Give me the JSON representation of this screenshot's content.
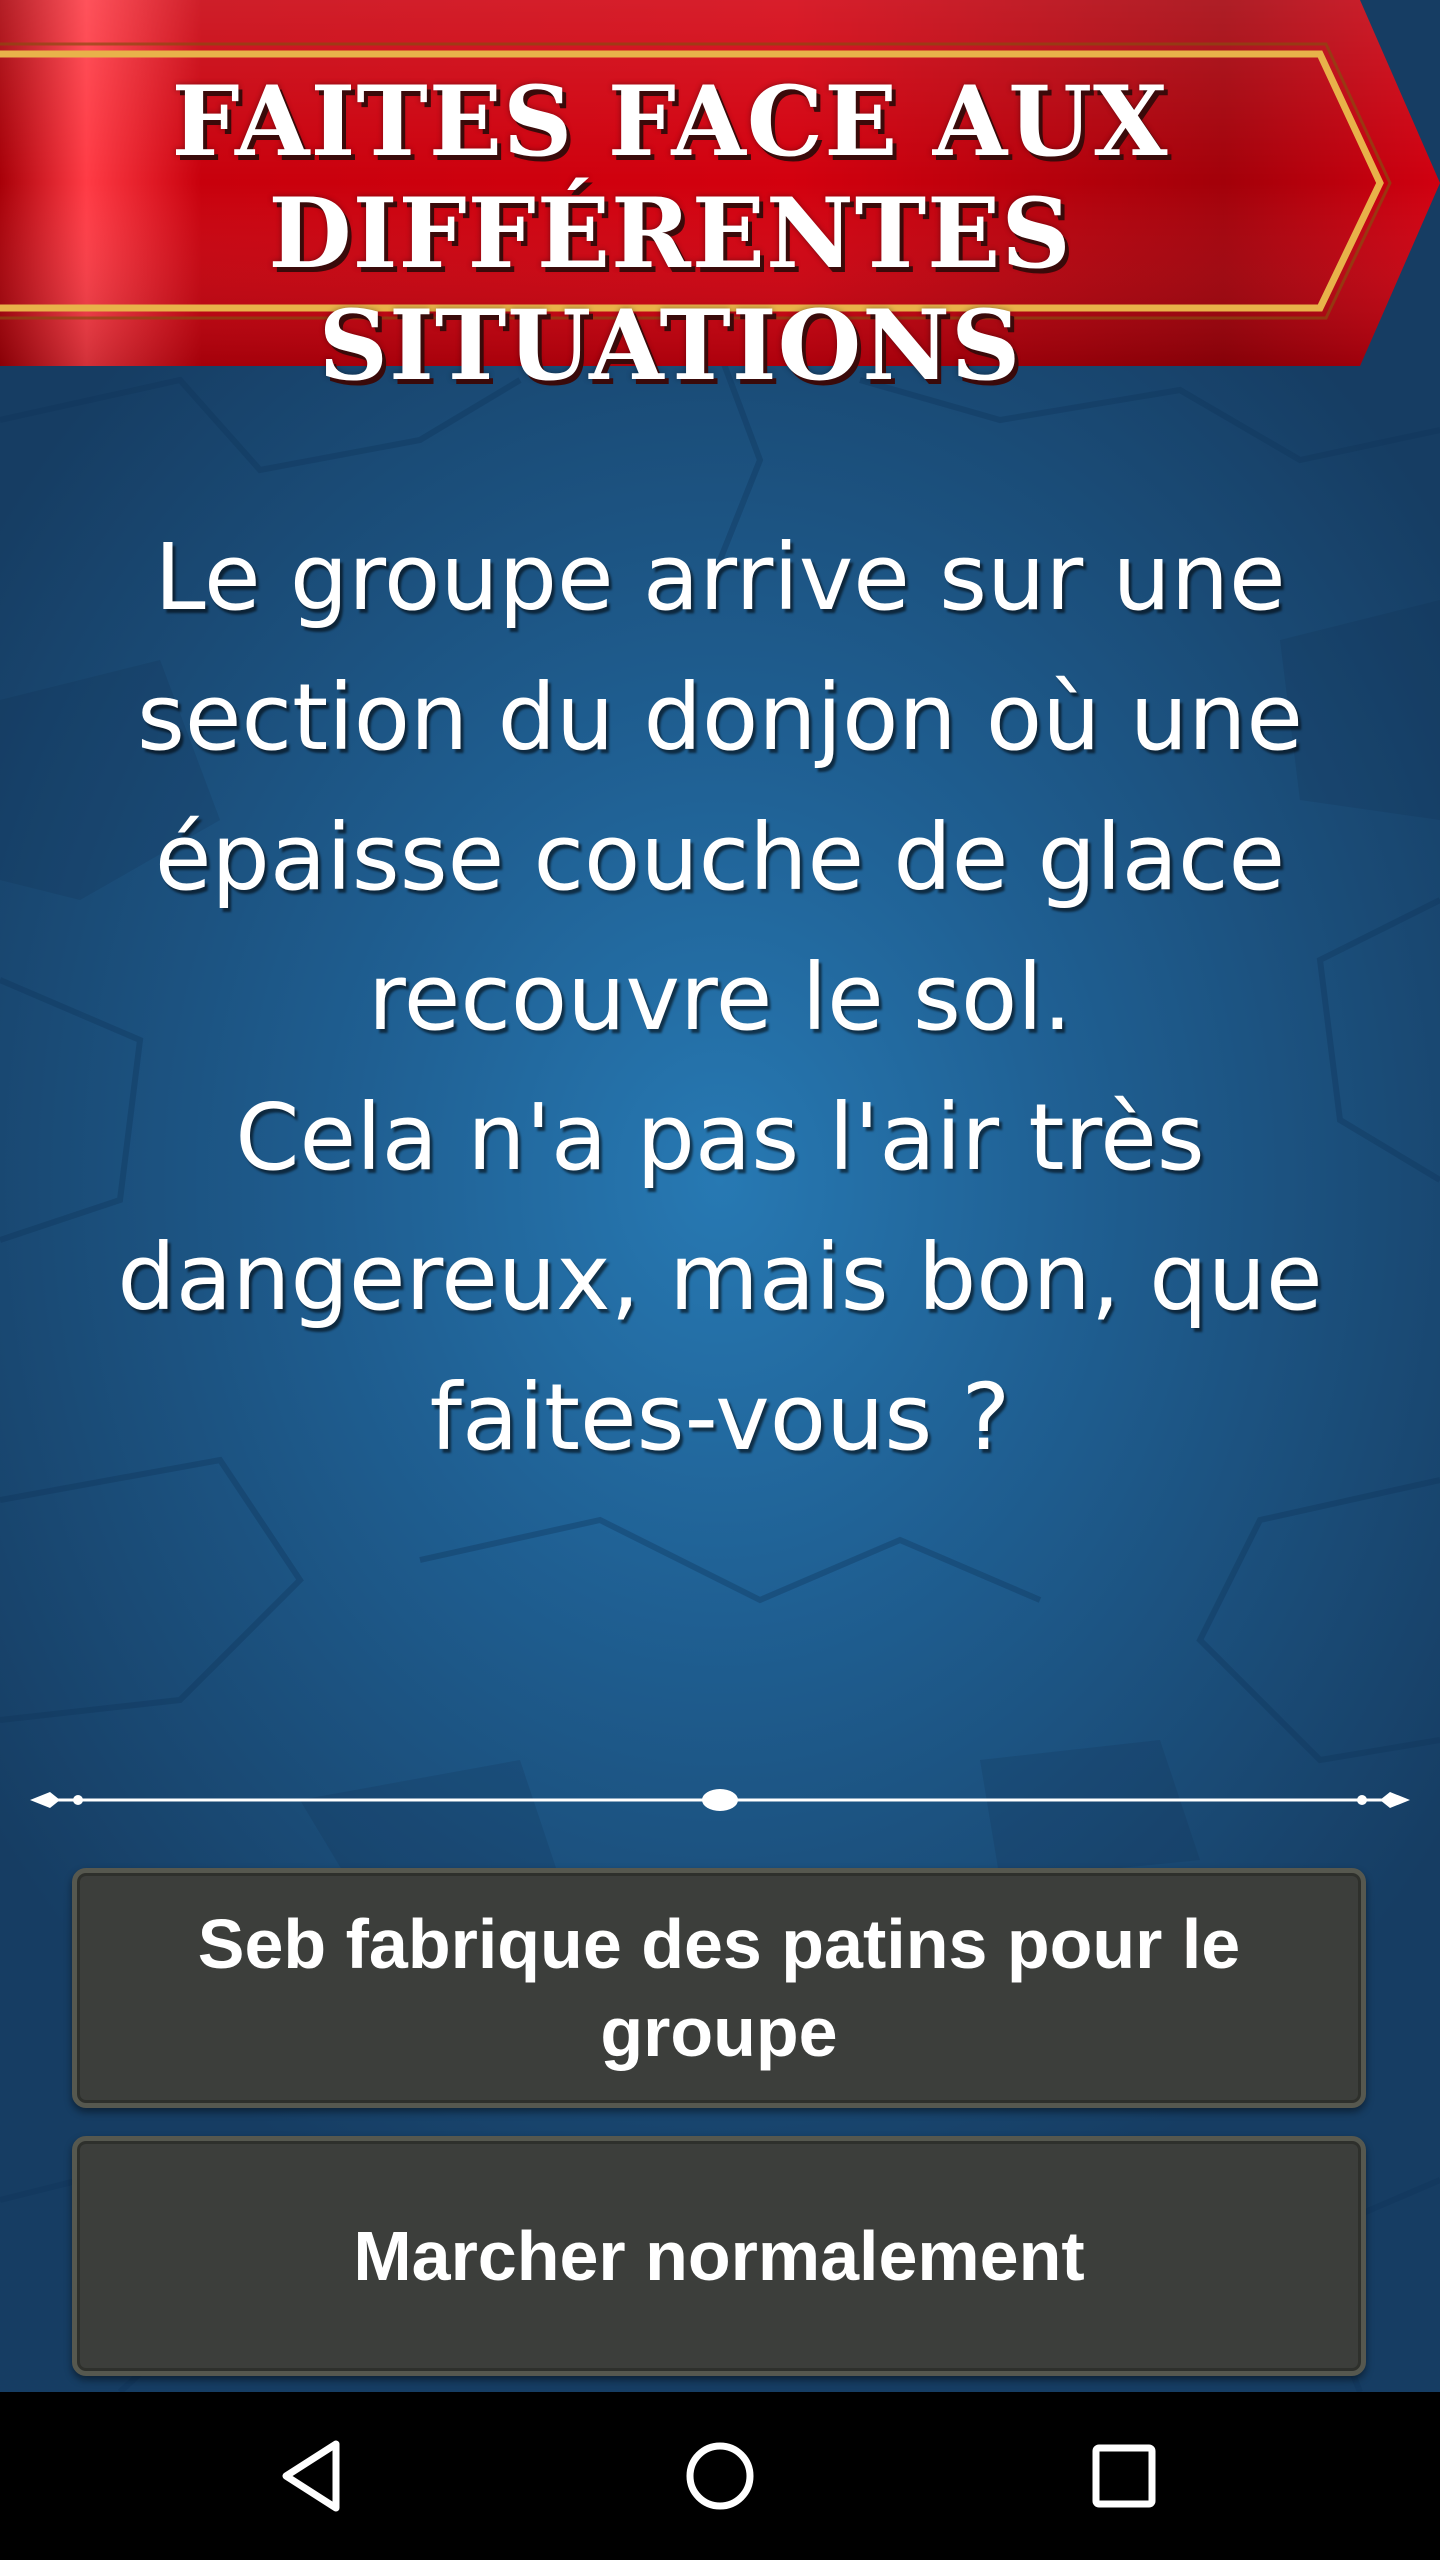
{
  "banner": {
    "line1": "FAITES FACE AUX",
    "line2": "DIFFÉRENTES SITUATIONS"
  },
  "story": {
    "lines": [
      "Le groupe arrive sur une",
      "section du donjon où une",
      "épaisse couche de glace",
      "recouvre le sol.",
      "Cela n'a pas l'air très",
      "dangereux, mais bon, que",
      "faites-vous ?"
    ]
  },
  "choices": [
    {
      "label": "Seb fabrique des patins pour le groupe"
    },
    {
      "label": "Marcher normalement"
    }
  ],
  "navbar": {
    "back_icon": "back-triangle-icon",
    "home_icon": "home-circle-icon",
    "recent_icon": "recent-apps-square-icon"
  },
  "colors": {
    "banner_red": "#c4000b",
    "banner_gold": "#e8b24a",
    "background_blue": "#1f5f92",
    "button_fill": "#3c3e3b"
  }
}
